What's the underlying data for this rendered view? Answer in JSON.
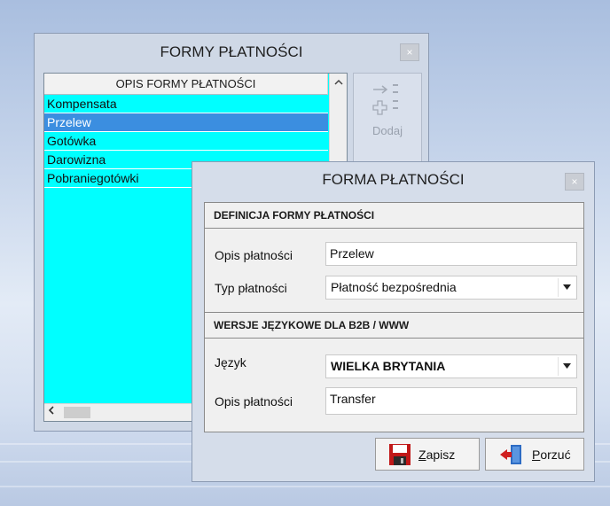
{
  "list_window": {
    "title": "FORMY PŁATNOŚCI",
    "close_glyph": "×",
    "column_header": "OPIS FORMY PŁATNOŚCI",
    "items": [
      "Kompensata",
      "Przelew",
      "Gotówka",
      "Darowizna",
      "Pobraniegotówki"
    ],
    "selected_item": "Przelew",
    "side_buttons": {
      "add_label": "Dodaj"
    }
  },
  "dialog": {
    "title": "FORMA PŁATNOŚCI",
    "close_glyph": "×",
    "definition_section": {
      "header": "DEFINICJA FORMY PŁATNOŚCI",
      "description_label": "Opis płatności",
      "description_value": "Przelew",
      "type_label": "Typ płatności",
      "type_value": "Płatność bezpośrednia"
    },
    "language_section": {
      "header": "WERSJE JĘZYKOWE DLA  B2B / WWW",
      "language_label": "Język",
      "language_value": "WIELKA BRYTANIA",
      "description_label": "Opis płatności",
      "description_value": "Transfer"
    },
    "buttons": {
      "save_mnemonic": "Z",
      "save_rest": "apisz",
      "cancel_mnemonic": "P",
      "cancel_rest": "orzuć"
    }
  },
  "colors": {
    "list_background": "#00ffff",
    "selection": "#3b8ee0",
    "window_frame": "#d5ddea"
  }
}
